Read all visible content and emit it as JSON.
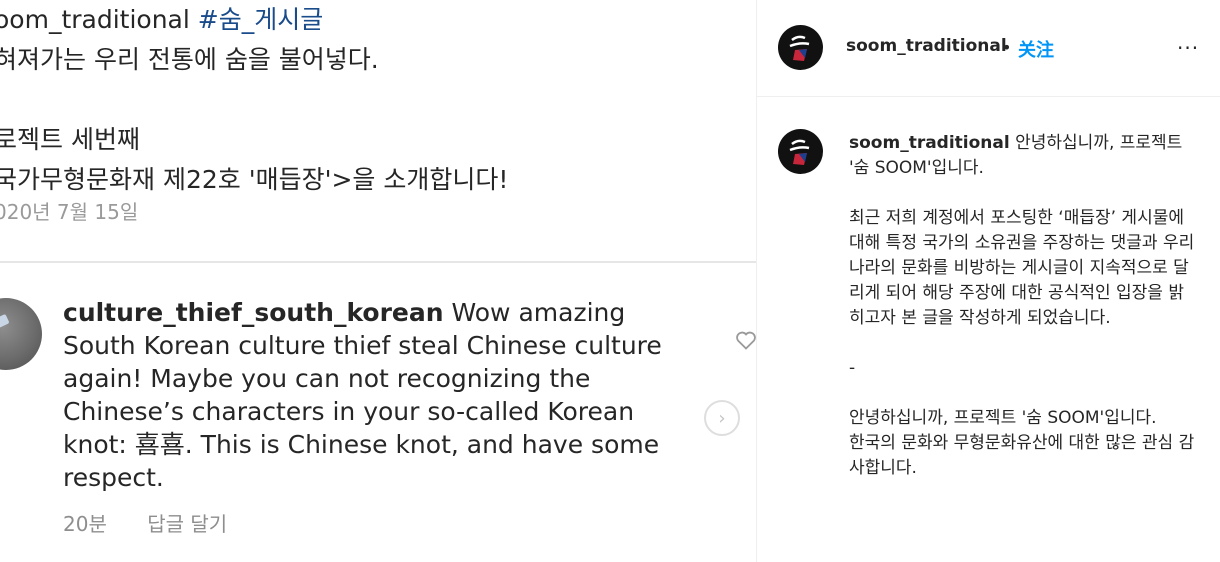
{
  "left_image": {
    "caption": {
      "user": "oom_traditional",
      "hashtag": "#숨_게시글",
      "lines": [
        "혀져가는 우리 전통에 숨을 불어넣다.",
        "",
        "로젝트 세번째",
        "국가무형문화재 제22호 '매듭장'>을 소개합니다!"
      ],
      "date": "020년 7월 15일"
    },
    "comment": {
      "user": "culture_thief_south_korean",
      "text": " Wow amazing South Korean culture thief steal Chinese culture again! Maybe you can not recognizing the Chinese’s characters in your so-called Korean knot: 喜喜. This is Chinese knot, and have some respect.",
      "time": "20분",
      "reply": "답글 달기"
    }
  },
  "post": {
    "header": {
      "username": "soom_traditional",
      "dot": "•",
      "follow_label": "关注",
      "more_icon": "···"
    },
    "caption": {
      "username": "soom_traditional",
      "text": " 안녕하십니까, 프로젝트 '숨 SOOM'입니다.\n\n최근 저희 계정에서 포스팅한 ‘매듭장’ 게시물에 대해 특정 국가의 소유권을 주장하는 댓글과 우리나라의 문화를 비방하는 게시글이 지속적으로 달리게 되어 해당 주장에 대한 공식적인 입장을 밝히고자 본 글을 작성하게 되었습니다.\n\n-\n\n안녕하십니까, 프로젝트 '숨 SOOM'입니다.\n한국의 문화와 무형문화유산에 대한 많은 관심 감사합니다."
    }
  },
  "colors": {
    "accent": "#0095f6",
    "hashtag": "#1a4b8a",
    "muted": "#8e8e8e"
  }
}
